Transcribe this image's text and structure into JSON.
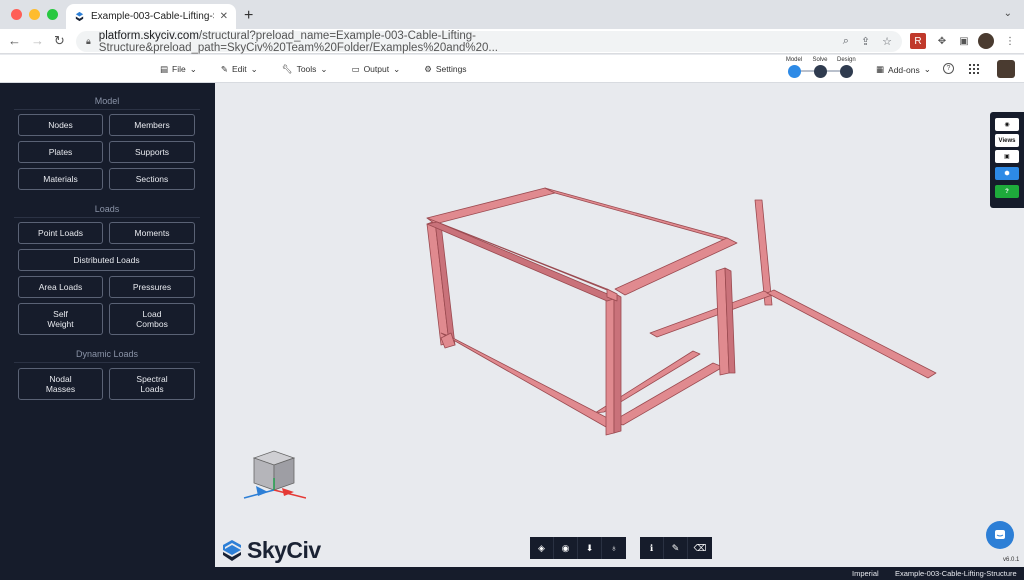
{
  "browser": {
    "tab_title": "Example-003-Cable-Lifting-St",
    "url_host": "platform.skyciv.com",
    "url_path": "/structural?preload_name=Example-003-Cable-Lifting-Structure&preload_path=SkyCiv%20Team%20Folder/Examples%20and%20..."
  },
  "menu": {
    "file": "File",
    "edit": "Edit",
    "tools": "Tools",
    "output": "Output",
    "settings": "Settings"
  },
  "workflow": {
    "model": "Model",
    "solve": "Solve",
    "design": "Design",
    "model_color": "#2d8ae6",
    "solve_color": "#2f3b4f",
    "design_color": "#2f3b4f"
  },
  "addons": "Add-ons",
  "sidebar": {
    "model_heading": "Model",
    "model_buttons": [
      "Nodes",
      "Members",
      "Plates",
      "Supports",
      "Materials",
      "Sections"
    ],
    "loads_heading": "Loads",
    "loads_buttons": [
      "Point Loads",
      "Moments",
      "Distributed Loads",
      "Area Loads",
      "Pressures"
    ],
    "self_weight": {
      "line1": "Self",
      "line2": "Weight"
    },
    "load_combos": {
      "line1": "Load",
      "line2": "Combos"
    },
    "dynamic_heading": "Dynamic Loads",
    "nodal_masses": {
      "line1": "Nodal",
      "line2": "Masses"
    },
    "spectral_loads": {
      "line1": "Spectral",
      "line2": "Loads"
    }
  },
  "right_tools": {
    "views": "Views",
    "help": "?"
  },
  "logo": "SkyCiv",
  "version": "v6.0.1",
  "status": {
    "units": "Imperial",
    "file": "Example-003-Cable-Lifting-Structure"
  },
  "colors": {
    "member": "#e08a8f",
    "sidebar_bg": "#161c2b",
    "viewport_bg": "#e8eaee"
  }
}
